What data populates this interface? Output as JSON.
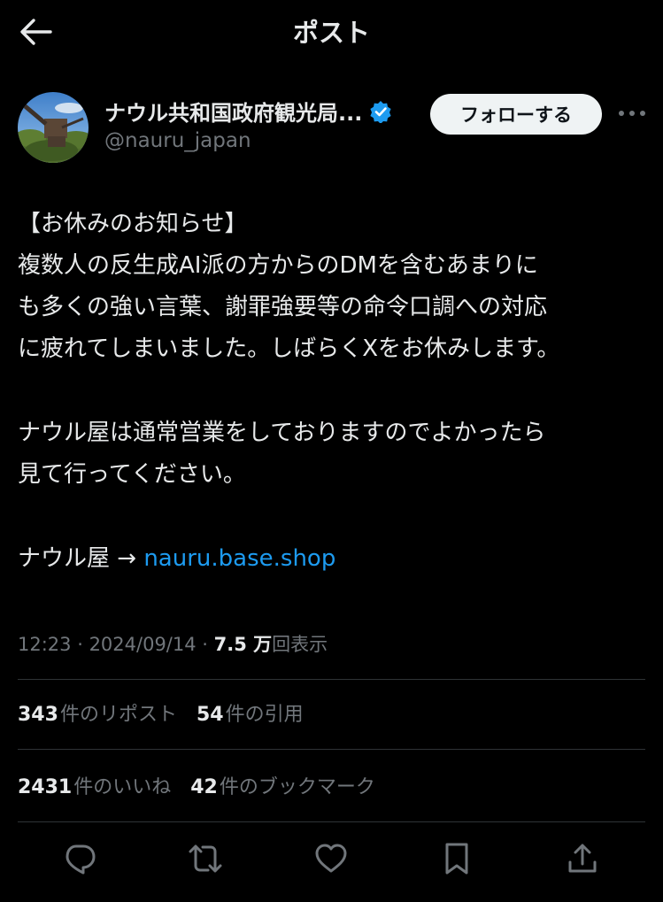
{
  "header": {
    "title": "ポスト"
  },
  "author": {
    "display_name": "ナウル共和国政府観光局...",
    "handle": "@nauru_japan",
    "verified": true,
    "follow_label": "フォローする"
  },
  "post": {
    "lines": [
      "【お休みのお知らせ】",
      "複数人の反生成AI派の方からのDMを含むあまりに",
      "も多くの強い言葉、謝罪強要等の命令口調への対応",
      "に疲れてしまいました。しばらくXをお休みします。",
      "",
      "ナウル屋は通常営業をしておりますのでよかったら",
      "見て行ってください。",
      "",
      "ナウル屋 → "
    ],
    "link_text": "nauru.base.shop"
  },
  "meta": {
    "time": "12:23",
    "separator": " · ",
    "date": "2024/09/14",
    "views_number": "7.5 万",
    "views_label": "回表示"
  },
  "stats_row1": [
    {
      "number": "343",
      "label": "件のリポスト"
    },
    {
      "number": "54",
      "label": "件の引用"
    }
  ],
  "stats_row2": [
    {
      "number": "2431",
      "label": "件のいいね"
    },
    {
      "number": "42",
      "label": "件のブックマーク"
    }
  ],
  "actions": [
    "reply-icon",
    "repost-icon",
    "like-icon",
    "bookmark-icon",
    "share-icon"
  ],
  "colors": {
    "background": "#000000",
    "text": "#e7e9ea",
    "secondary": "#71767b",
    "link": "#1d9bf0",
    "verified": "#1d9bf0",
    "divider": "#2f3336"
  }
}
